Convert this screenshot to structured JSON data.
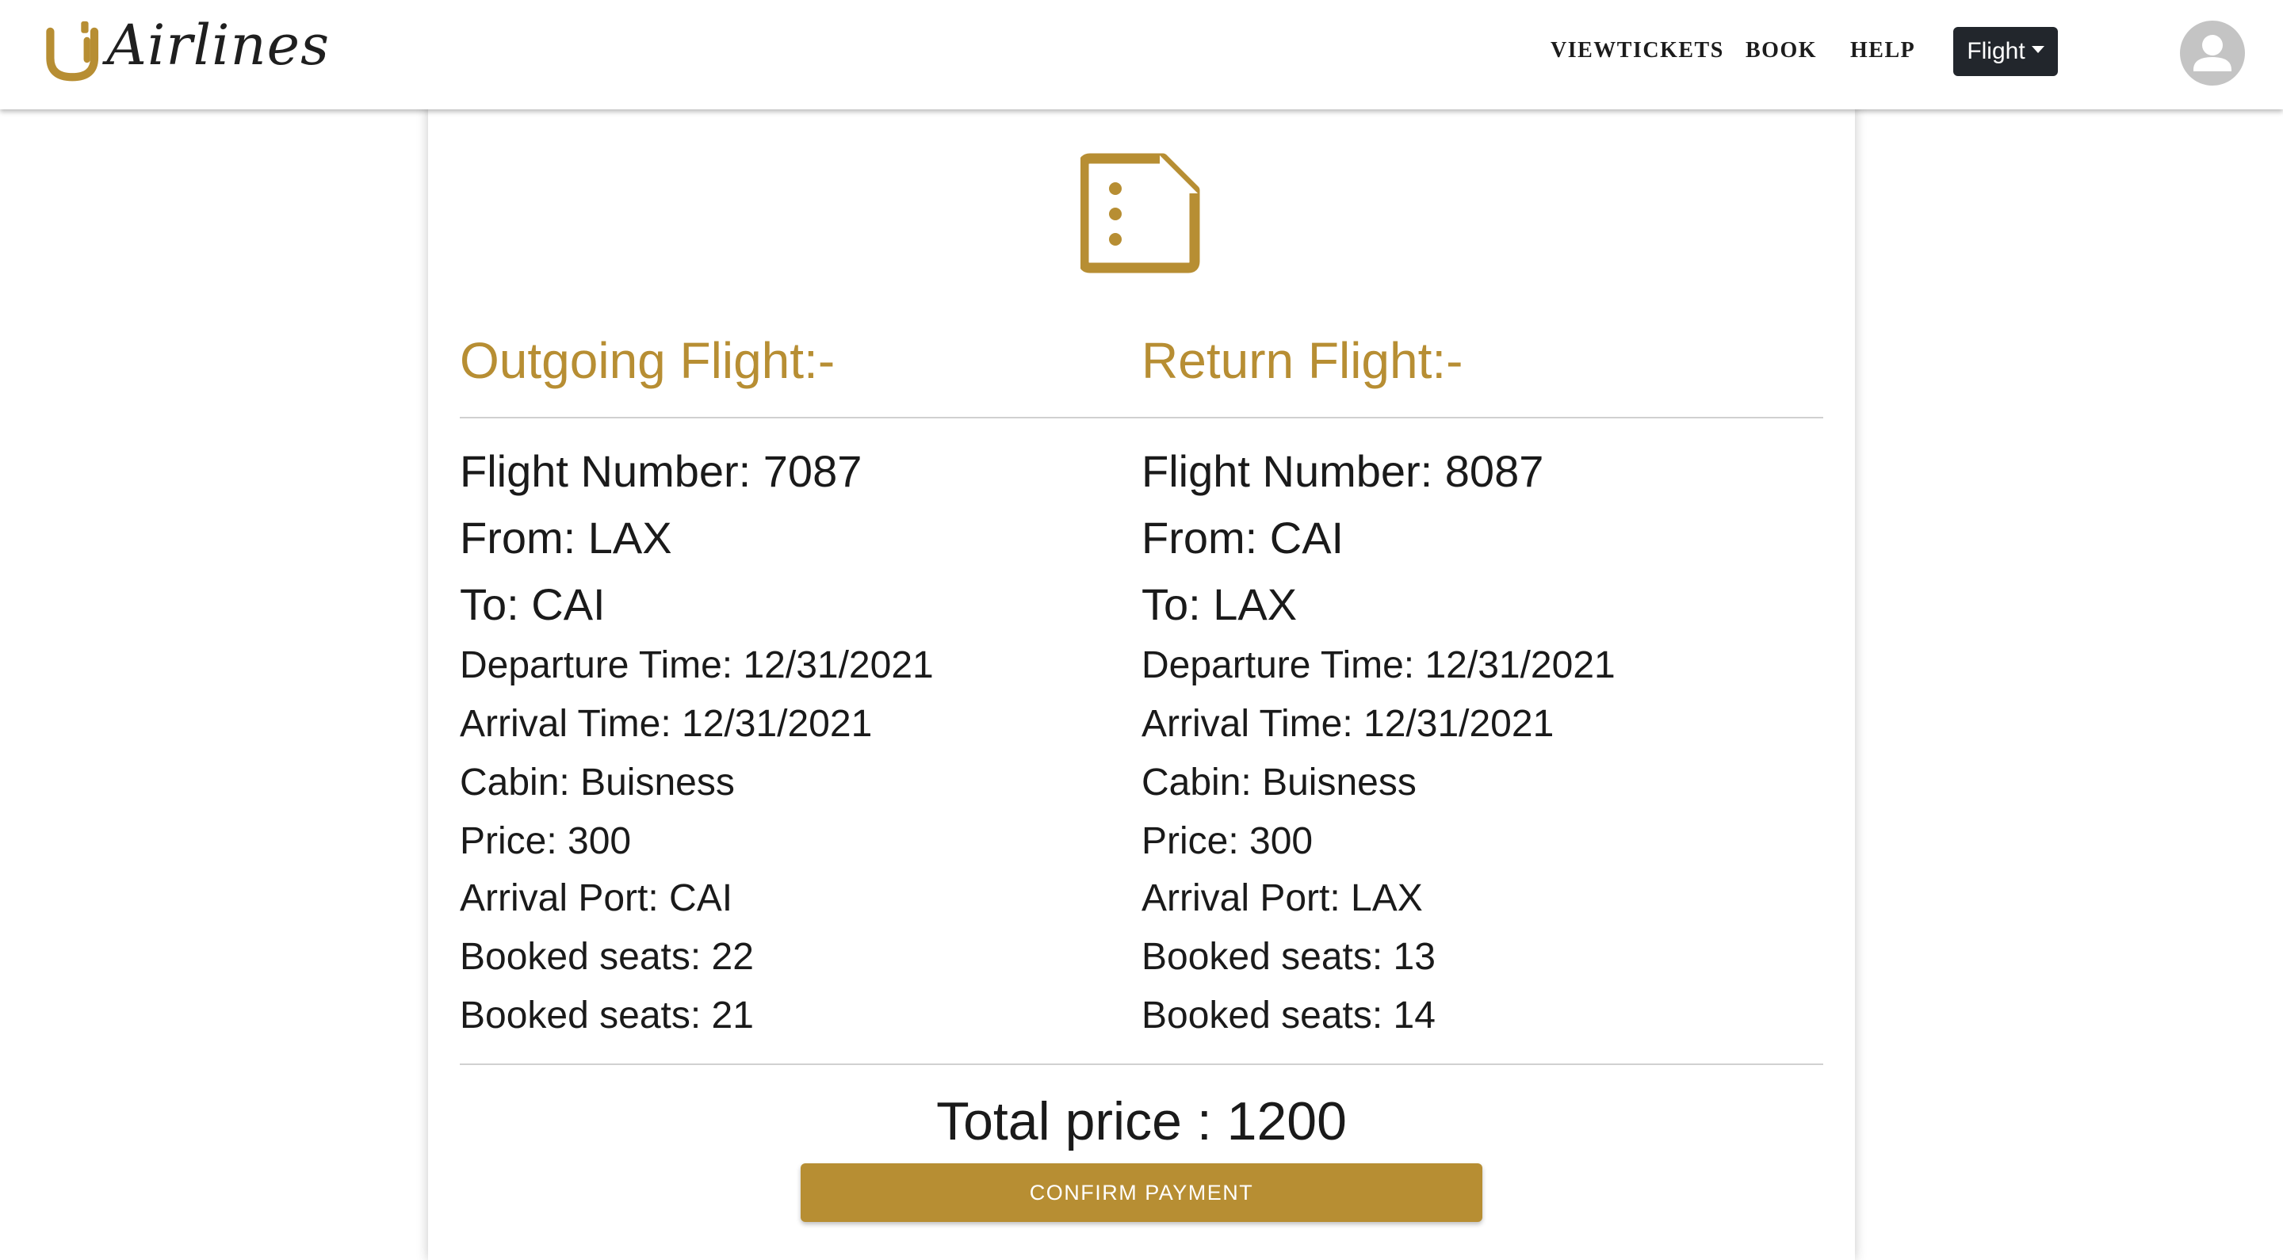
{
  "header": {
    "logo_text": "Airlines",
    "nav": {
      "viewtickets": "VIEWTICKETS",
      "book": "BOOK",
      "help": "HELP"
    },
    "flight_dropdown": "Flight",
    "avatar_icon": "user-avatar-icon"
  },
  "colors": {
    "accent": "#b78e33",
    "dark_button": "#22262c",
    "text": "#1a1a1a",
    "avatar_bg": "#c4c4c4"
  },
  "summary_icon": "document-list-icon",
  "outgoing": {
    "title": "Outgoing Flight:-",
    "flight_number": "Flight Number: 7087",
    "from": "From: LAX",
    "to": "To: CAI",
    "departure_time": "Departure Time: 12/31/2021",
    "arrival_time": "Arrival Time: 12/31/2021",
    "cabin": "Cabin: Buisness",
    "price": "Price: 300",
    "arrival_port": "Arrival Port: CAI",
    "booked_seats_1": "Booked seats: 22",
    "booked_seats_2": "Booked seats: 21"
  },
  "return": {
    "title": "Return Flight:-",
    "flight_number": "Flight Number: 8087",
    "from": "From: CAI",
    "to": "To: LAX",
    "departure_time": "Departure Time: 12/31/2021",
    "arrival_time": "Arrival Time: 12/31/2021",
    "cabin": "Cabin: Buisness",
    "price": "Price: 300",
    "arrival_port": "Arrival Port: LAX",
    "booked_seats_1": "Booked seats: 13",
    "booked_seats_2": "Booked seats: 14"
  },
  "total_price": "Total price : 1200",
  "confirm_button": "CONFIRM PAYMENT"
}
